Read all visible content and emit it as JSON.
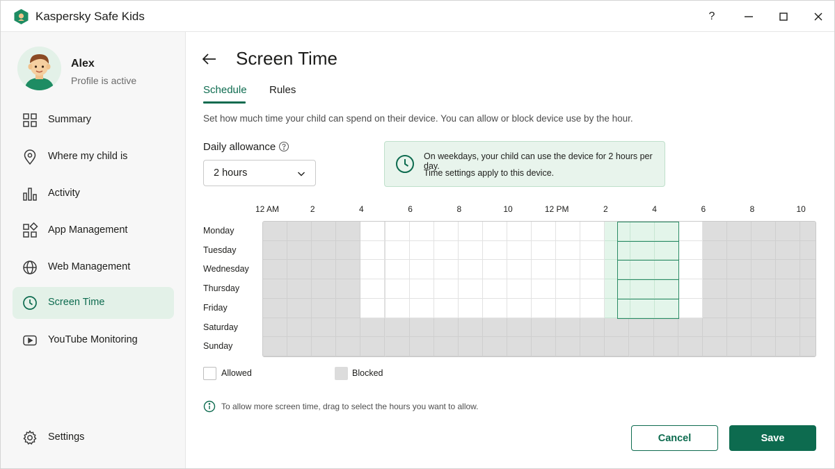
{
  "app": {
    "title": "Kaspersky Safe Kids",
    "window_controls": {
      "help": "?",
      "minimize": "—",
      "maximize": "☐",
      "close": "✕"
    }
  },
  "colors": {
    "accent": "#0d6b4f",
    "accent_light": "#e3f1e8",
    "blocked_cell": "#dddddd",
    "allowed_cell": "#ffffff",
    "selected_cell": "#e3f5ea"
  },
  "profile": {
    "name": "Alex",
    "status": "Profile is active"
  },
  "sidebar": {
    "items": [
      {
        "label": "Summary",
        "icon": "grid-icon"
      },
      {
        "label": "Where my child is",
        "icon": "location-pin-icon"
      },
      {
        "label": "Activity",
        "icon": "bar-chart-icon"
      },
      {
        "label": "App Management",
        "icon": "apps-icon"
      },
      {
        "label": "Web Management",
        "icon": "globe-icon"
      },
      {
        "label": "Screen Time",
        "icon": "clock-icon",
        "active": true
      },
      {
        "label": "YouTube Monitoring",
        "icon": "youtube-play-icon"
      }
    ],
    "settings_label": "Settings"
  },
  "main": {
    "title": "Screen Time",
    "tabs": [
      {
        "label": "Schedule",
        "active": true
      },
      {
        "label": "Rules",
        "active": false
      }
    ],
    "description": "Set how much time your child can spend on their device. You can allow or block device use by the hour.",
    "allowance": {
      "label": "Daily allowance",
      "value": "2 hours"
    },
    "info": {
      "line1": "On weekdays, your child can use the device for 2 hours per day.",
      "line2": "Time settings apply to this device."
    },
    "schedule": {
      "hour_labels": [
        "12 AM",
        "2",
        "4",
        "6",
        "8",
        "10",
        "12 PM",
        "2",
        "4",
        "6",
        "8",
        "10"
      ],
      "days": [
        "Monday",
        "Tuesday",
        "Wednesday",
        "Thursday",
        "Friday",
        "Saturday",
        "Sunday"
      ],
      "half_hour_slots": 48,
      "weekday_allowed_hours": [
        4,
        18
      ],
      "weekday_selected_hours": [
        14.5,
        17
      ],
      "weekend_allowed_hours": []
    },
    "legend": {
      "allowed": "Allowed",
      "blocked": "Blocked"
    },
    "hint": "To allow more screen time, drag to select the hours you want to allow.",
    "buttons": {
      "cancel": "Cancel",
      "save": "Save"
    }
  }
}
